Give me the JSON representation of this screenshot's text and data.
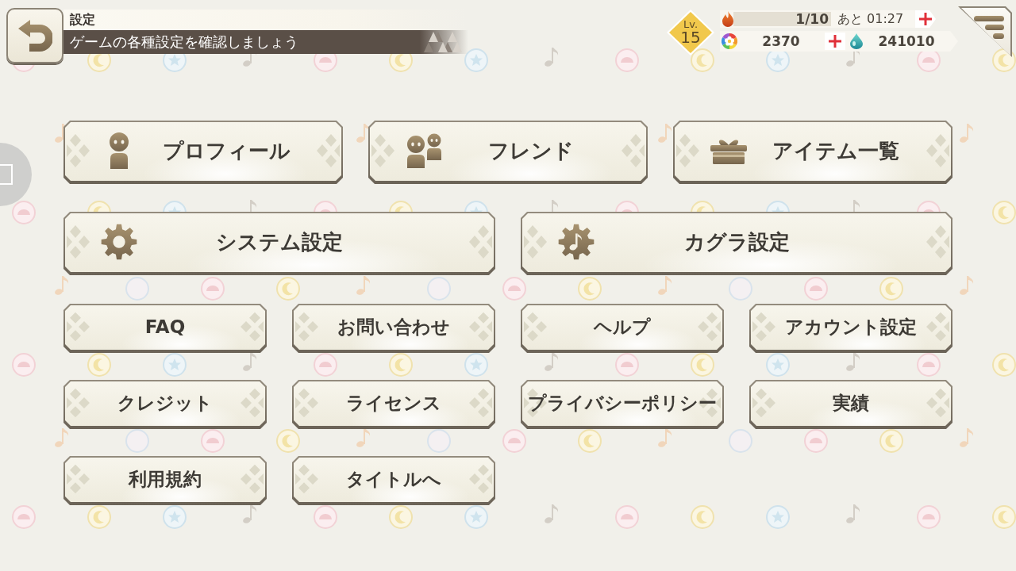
{
  "header": {
    "title": "設定",
    "subtitle": "ゲームの各種設定を確認しましょう"
  },
  "status": {
    "level_prefix": "Lv.",
    "player_level": "15",
    "stamina": "1/10",
    "recovery_timer": "あと 01:27",
    "gems": "2370",
    "coins": "241010"
  },
  "feature_rows": [
    [
      {
        "label": "プロフィール",
        "kind": "profile"
      },
      {
        "label": "フレンド",
        "kind": "friends"
      },
      {
        "label": "アイテム一覧",
        "kind": "items"
      }
    ],
    [
      {
        "label": "システム設定",
        "kind": "system"
      },
      {
        "label": "カグラ設定",
        "kind": "kagura"
      }
    ]
  ],
  "link_rows": [
    [
      "FAQ",
      "お問い合わせ",
      "ヘルプ",
      "アカウント設定"
    ],
    [
      "クレジット",
      "ライセンス",
      "プライバシーポリシー",
      "実績"
    ],
    [
      "利用規約",
      "タイトルへ"
    ]
  ]
}
